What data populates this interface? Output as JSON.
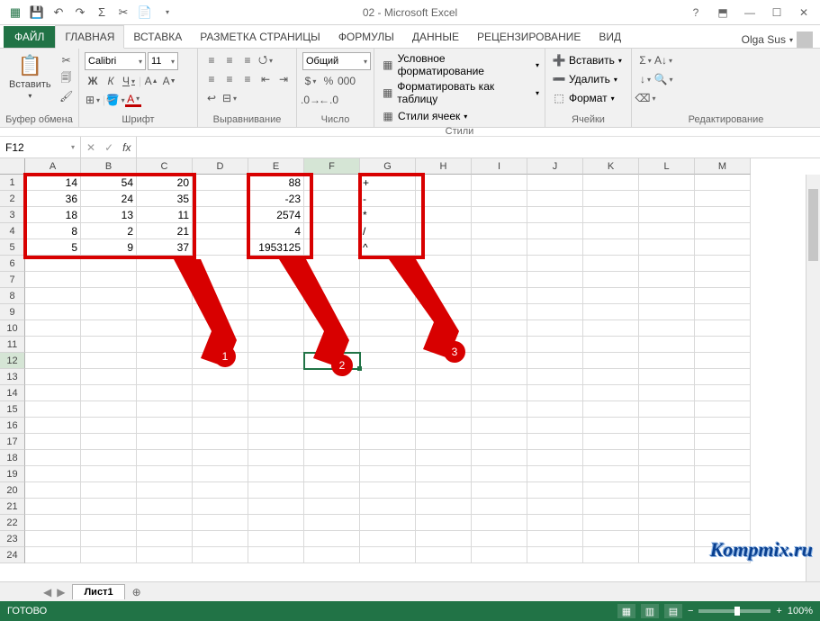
{
  "title": "02 - Microsoft Excel",
  "tabs": {
    "file": "ФАЙЛ",
    "list": [
      "ГЛАВНАЯ",
      "ВСТАВКА",
      "РАЗМЕТКА СТРАНИЦЫ",
      "ФОРМУЛЫ",
      "ДАННЫЕ",
      "РЕЦЕНЗИРОВАНИЕ",
      "ВИД"
    ],
    "active": 0
  },
  "user": {
    "name": "Olga Sus"
  },
  "ribbon": {
    "clipboard": {
      "paste": "Вставить",
      "label": "Буфер обмена"
    },
    "font": {
      "name": "Calibri",
      "size": "11",
      "label": "Шрифт",
      "bold": "Ж",
      "italic": "К",
      "underline": "Ч"
    },
    "alignment": {
      "label": "Выравнивание"
    },
    "number": {
      "format": "Общий",
      "label": "Число"
    },
    "styles": {
      "conditional": "Условное форматирование",
      "as_table": "Форматировать как таблицу",
      "cell_styles": "Стили ячеек",
      "label": "Стили"
    },
    "cells": {
      "insert": "Вставить",
      "delete": "Удалить",
      "format": "Формат",
      "label": "Ячейки"
    },
    "editing": {
      "label": "Редактирование"
    }
  },
  "name_box": "F12",
  "columns": [
    "A",
    "B",
    "C",
    "D",
    "E",
    "F",
    "G",
    "H",
    "I",
    "J",
    "K",
    "L",
    "M"
  ],
  "row_count": 24,
  "active_col": 5,
  "active_row": 12,
  "sheet_tabs": {
    "active": "Лист1"
  },
  "status": {
    "ready": "ГОТОВО",
    "zoom": "100%"
  },
  "watermark": "Kompmix.ru",
  "cells": {
    "A1": "14",
    "B1": "54",
    "C1": "20",
    "E1": "88",
    "G1": "+",
    "A2": "36",
    "B2": "24",
    "C2": "35",
    "E2": "-23",
    "G2": "-",
    "A3": "18",
    "B3": "13",
    "C3": "11",
    "E3": "2574",
    "G3": "*",
    "A4": "8",
    "B4": "2",
    "C4": "21",
    "E4": "4",
    "G4": "/",
    "A5": "5",
    "B5": "9",
    "C5": "37",
    "E5": "1953125",
    "G5": "^"
  },
  "badges": [
    "1",
    "2",
    "3"
  ]
}
